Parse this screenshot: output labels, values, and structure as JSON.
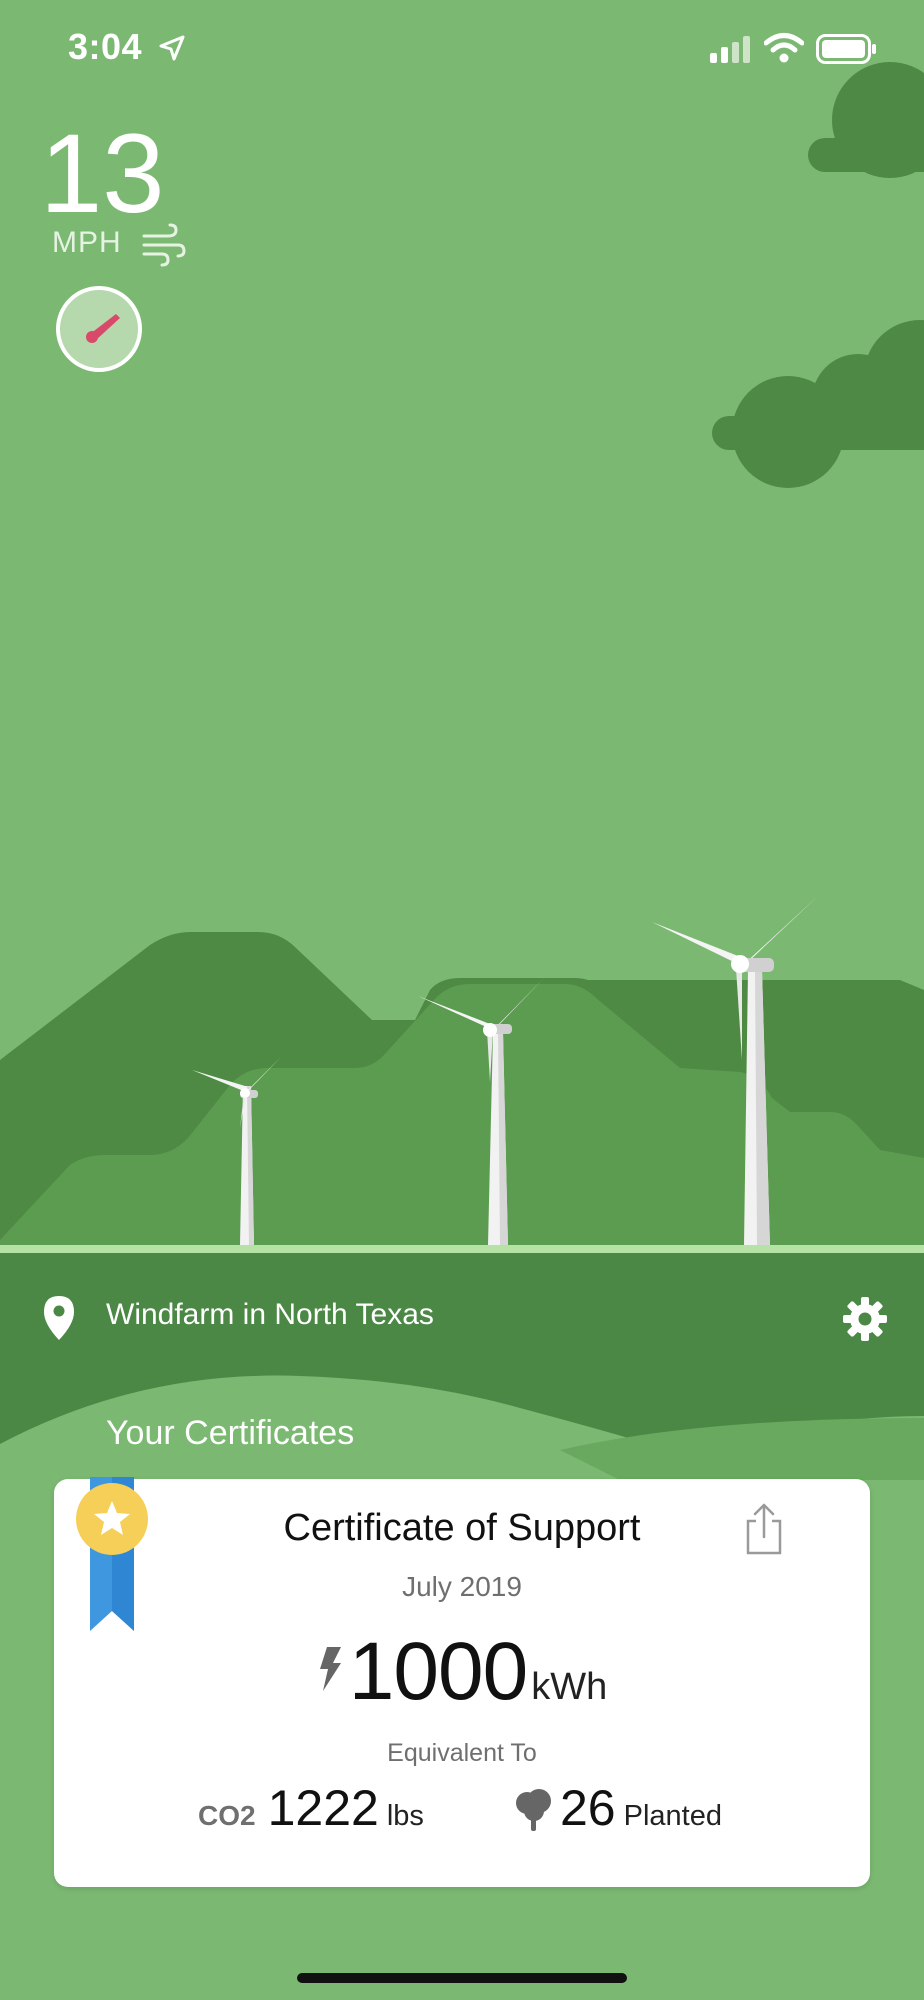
{
  "status_bar": {
    "time": "3:04",
    "icons": [
      "location-arrow-icon",
      "signal-icon",
      "wifi-icon",
      "battery-icon"
    ]
  },
  "wind": {
    "speed": "13",
    "unit": "MPH",
    "icons": [
      "wind-icon",
      "wind-direction-gauge-icon"
    ]
  },
  "location": {
    "name": "Windfarm in North Texas",
    "icons": [
      "map-pin-icon",
      "gear-icon"
    ]
  },
  "certificates": {
    "section_title": "Your Certificates",
    "items": [
      {
        "title": "Certificate of Support",
        "date": "July 2019",
        "energy_value": "1000",
        "energy_unit": "kWh",
        "equivalent_label": "Equivalent To",
        "co2_label": "CO2",
        "co2_value": "1222",
        "co2_unit": "lbs",
        "trees_value": "26",
        "trees_label": "Planted",
        "icons": [
          "ribbon-star-icon",
          "share-icon",
          "lightning-icon",
          "tree-icon"
        ]
      }
    ]
  },
  "colors": {
    "sky": "#7bb972",
    "hill_dark": "#4f8a45",
    "hill_mid": "#5c9c50",
    "band": "#4c8845",
    "cloud": "#4e8a45",
    "needle": "#d94a6a",
    "ribbon": "#3f97e0",
    "medal": "#f6cf58"
  }
}
